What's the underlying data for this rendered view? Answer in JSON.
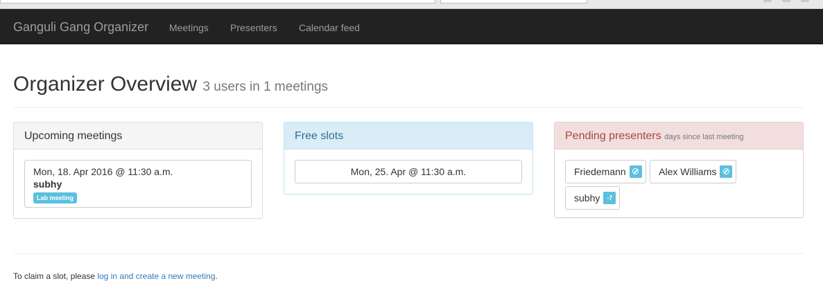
{
  "navbar": {
    "brand": "Ganguli Gang Organizer",
    "links": [
      "Meetings",
      "Presenters",
      "Calendar feed"
    ]
  },
  "header": {
    "title": "Organizer Overview",
    "subtitle": "3 users in 1 meetings"
  },
  "upcoming": {
    "heading": "Upcoming meetings",
    "items": [
      {
        "date": "Mon, 18. Apr 2016 @ 11:30 a.m.",
        "presenter": "subhy",
        "label": "Lab meeting"
      }
    ]
  },
  "free_slots": {
    "heading": "Free slots",
    "slots": [
      "Mon, 25. Apr @ 11:30 a.m."
    ]
  },
  "pending": {
    "heading": "Pending presenters",
    "subheading": "days since last meeting",
    "presenters": [
      {
        "name": "Friedemann",
        "badge": "",
        "badge_icon": "ban-icon"
      },
      {
        "name": "Alex Williams",
        "badge": "",
        "badge_icon": "ban-icon"
      },
      {
        "name": "subhy",
        "badge": "-7"
      }
    ]
  },
  "footer": {
    "text": "To claim a slot, please",
    "link": "log in and create a new meeting",
    "end": "."
  },
  "colors": {
    "navbar": "#222222",
    "info": "#5bc0de",
    "link": "#337ab7",
    "danger_heading": "#a94442",
    "info_heading": "#31708f"
  }
}
